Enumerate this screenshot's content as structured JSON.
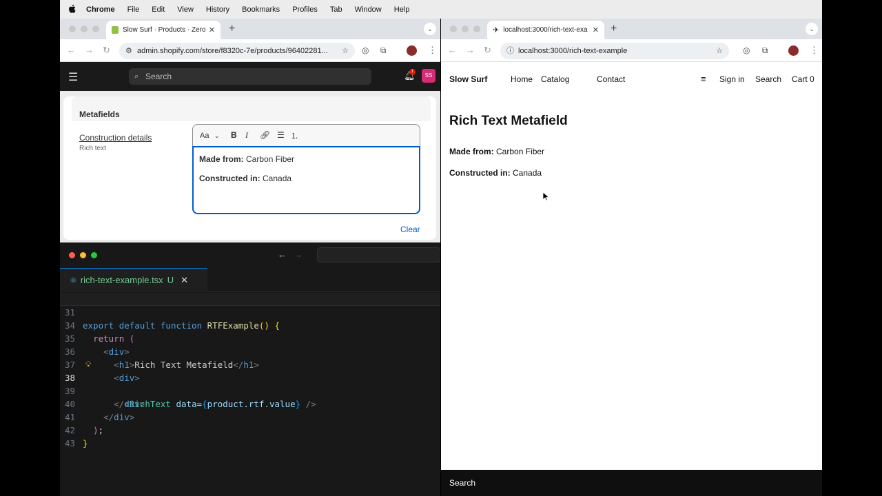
{
  "menubar": {
    "apple": "",
    "app": "Chrome",
    "items": [
      "File",
      "Edit",
      "View",
      "History",
      "Bookmarks",
      "Profiles",
      "Tab",
      "Window",
      "Help"
    ]
  },
  "left_browser": {
    "tab_title": "Slow Surf · Products · Zero G",
    "url": "admin.shopify.com/store/f8320c-7e/products/96402281...",
    "shopify": {
      "search_placeholder": "Search",
      "notification_count": "1",
      "avatar_initials": "SS",
      "section_title": "Metafields",
      "field_name": "Construction details",
      "field_type": "Rich text",
      "toolbar_font": "Aa",
      "rte_line1_label": "Made from:",
      "rte_line1_value": " Carbon Fiber",
      "rte_line2_label": "Constructed in:",
      "rte_line2_value": " Canada",
      "clear_label": "Clear"
    }
  },
  "editor": {
    "tab_filename": "rich-text-example.tsx",
    "tab_status": "U",
    "line_numbers": [
      "31",
      "34",
      "35",
      "36",
      "37",
      "38",
      "39",
      "40",
      "41",
      "42",
      "43"
    ],
    "code": {
      "l31_a": "export",
      "l31_b": "default",
      "l31_c": "function",
      "l31_d": "RTFExample",
      "l34_a": "return",
      "l36_text": "Rich Text Metafield",
      "l38_comp": "RichText",
      "l38_attr": "data",
      "l38_expr": "product.rtf.value"
    }
  },
  "right_browser": {
    "tab_title": "localhost:3000/rich-text-exa",
    "url": "localhost:3000/rich-text-example",
    "store": {
      "brand": "Slow Surf",
      "nav": [
        "Home",
        "Catalog",
        "Contact"
      ],
      "sign_in": "Sign in",
      "search": "Search",
      "cart": "Cart 0",
      "heading": "Rich Text Metafield",
      "line1_label": "Made from:",
      "line1_value": " Carbon Fiber",
      "line2_label": "Constructed in:",
      "line2_value": " Canada",
      "bottom_search": "Search"
    }
  },
  "colors": {
    "shopify_header": "#1a1a1a",
    "rte_focus_border": "#005bd3",
    "avatar_pink": "#d72c75",
    "editor_bg": "#181818",
    "modified_file_green": "#73c991"
  }
}
